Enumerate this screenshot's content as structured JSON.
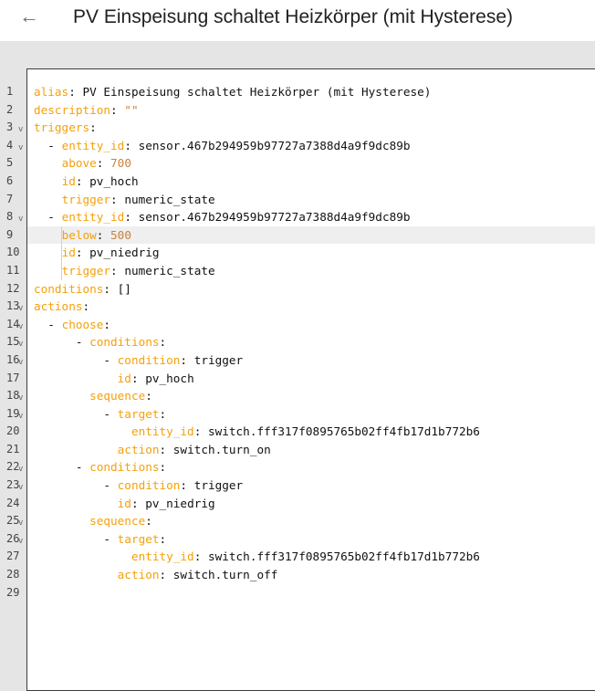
{
  "header": {
    "title": "PV Einspeisung schaltet Heizkörper (mit Hysterese)",
    "back_icon": "arrow-left-icon"
  },
  "colors": {
    "key": "#f5a00a",
    "number": "#c9823c",
    "active_line": "#efefef"
  },
  "editor": {
    "active_line": 9,
    "lines": [
      {
        "n": "1",
        "fold": false,
        "text": "alias: PV Einspeisung schaltet Heizkörper (mit Hysterese)"
      },
      {
        "n": "2",
        "fold": false,
        "text": "description: \"\""
      },
      {
        "n": "3",
        "fold": true,
        "text": "triggers:"
      },
      {
        "n": "4",
        "fold": true,
        "text": "  - entity_id: sensor.467b294959b97727a7388d4a9f9dc89b"
      },
      {
        "n": "5",
        "fold": false,
        "text": "    above: 700"
      },
      {
        "n": "6",
        "fold": false,
        "text": "    id: pv_hoch"
      },
      {
        "n": "7",
        "fold": false,
        "text": "    trigger: numeric_state"
      },
      {
        "n": "8",
        "fold": true,
        "text": "  - entity_id: sensor.467b294959b97727a7388d4a9f9dc89b"
      },
      {
        "n": "9",
        "fold": false,
        "text": "    below: 500"
      },
      {
        "n": "10",
        "fold": false,
        "text": "    id: pv_niedrig"
      },
      {
        "n": "11",
        "fold": false,
        "text": "    trigger: numeric_state"
      },
      {
        "n": "12",
        "fold": false,
        "text": "conditions: []"
      },
      {
        "n": "13",
        "fold": true,
        "text": "actions:"
      },
      {
        "n": "14",
        "fold": true,
        "text": "  - choose:"
      },
      {
        "n": "15",
        "fold": true,
        "text": "      - conditions:"
      },
      {
        "n": "16",
        "fold": true,
        "text": "          - condition: trigger"
      },
      {
        "n": "17",
        "fold": false,
        "text": "            id: pv_hoch"
      },
      {
        "n": "18",
        "fold": true,
        "text": "        sequence:"
      },
      {
        "n": "19",
        "fold": true,
        "text": "          - target:"
      },
      {
        "n": "20",
        "fold": false,
        "text": "              entity_id: switch.fff317f0895765b02ff4fb17d1b772b6"
      },
      {
        "n": "21",
        "fold": false,
        "text": "            action: switch.turn_on"
      },
      {
        "n": "22",
        "fold": true,
        "text": "      - conditions:"
      },
      {
        "n": "23",
        "fold": true,
        "text": "          - condition: trigger"
      },
      {
        "n": "24",
        "fold": false,
        "text": "            id: pv_niedrig"
      },
      {
        "n": "25",
        "fold": true,
        "text": "        sequence:"
      },
      {
        "n": "26",
        "fold": true,
        "text": "          - target:"
      },
      {
        "n": "27",
        "fold": false,
        "text": "              entity_id: switch.fff317f0895765b02ff4fb17d1b772b6"
      },
      {
        "n": "28",
        "fold": false,
        "text": "            action: switch.turn_off"
      },
      {
        "n": "29",
        "fold": false,
        "text": ""
      }
    ]
  }
}
